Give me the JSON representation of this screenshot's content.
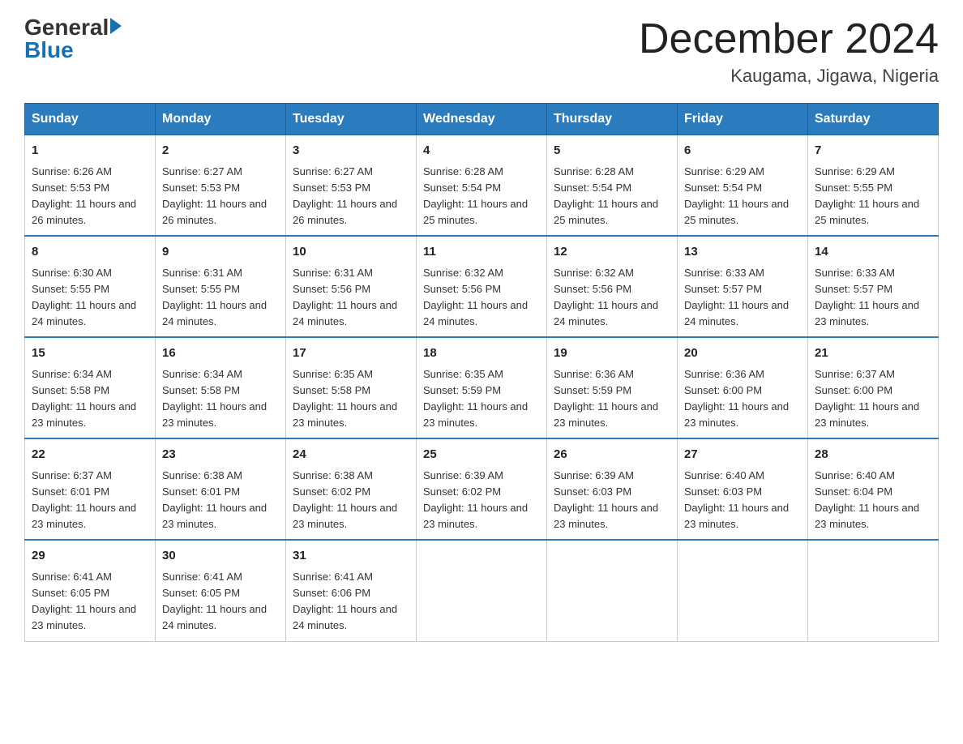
{
  "header": {
    "logo": {
      "general": "General",
      "blue": "Blue",
      "tagline": ""
    },
    "title": "December 2024",
    "location": "Kaugama, Jigawa, Nigeria"
  },
  "days_of_week": [
    "Sunday",
    "Monday",
    "Tuesday",
    "Wednesday",
    "Thursday",
    "Friday",
    "Saturday"
  ],
  "weeks": [
    [
      {
        "day": 1,
        "sunrise": "6:26 AM",
        "sunset": "5:53 PM",
        "daylight": "11 hours and 26 minutes."
      },
      {
        "day": 2,
        "sunrise": "6:27 AM",
        "sunset": "5:53 PM",
        "daylight": "11 hours and 26 minutes."
      },
      {
        "day": 3,
        "sunrise": "6:27 AM",
        "sunset": "5:53 PM",
        "daylight": "11 hours and 26 minutes."
      },
      {
        "day": 4,
        "sunrise": "6:28 AM",
        "sunset": "5:54 PM",
        "daylight": "11 hours and 25 minutes."
      },
      {
        "day": 5,
        "sunrise": "6:28 AM",
        "sunset": "5:54 PM",
        "daylight": "11 hours and 25 minutes."
      },
      {
        "day": 6,
        "sunrise": "6:29 AM",
        "sunset": "5:54 PM",
        "daylight": "11 hours and 25 minutes."
      },
      {
        "day": 7,
        "sunrise": "6:29 AM",
        "sunset": "5:55 PM",
        "daylight": "11 hours and 25 minutes."
      }
    ],
    [
      {
        "day": 8,
        "sunrise": "6:30 AM",
        "sunset": "5:55 PM",
        "daylight": "11 hours and 24 minutes."
      },
      {
        "day": 9,
        "sunrise": "6:31 AM",
        "sunset": "5:55 PM",
        "daylight": "11 hours and 24 minutes."
      },
      {
        "day": 10,
        "sunrise": "6:31 AM",
        "sunset": "5:56 PM",
        "daylight": "11 hours and 24 minutes."
      },
      {
        "day": 11,
        "sunrise": "6:32 AM",
        "sunset": "5:56 PM",
        "daylight": "11 hours and 24 minutes."
      },
      {
        "day": 12,
        "sunrise": "6:32 AM",
        "sunset": "5:56 PM",
        "daylight": "11 hours and 24 minutes."
      },
      {
        "day": 13,
        "sunrise": "6:33 AM",
        "sunset": "5:57 PM",
        "daylight": "11 hours and 24 minutes."
      },
      {
        "day": 14,
        "sunrise": "6:33 AM",
        "sunset": "5:57 PM",
        "daylight": "11 hours and 23 minutes."
      }
    ],
    [
      {
        "day": 15,
        "sunrise": "6:34 AM",
        "sunset": "5:58 PM",
        "daylight": "11 hours and 23 minutes."
      },
      {
        "day": 16,
        "sunrise": "6:34 AM",
        "sunset": "5:58 PM",
        "daylight": "11 hours and 23 minutes."
      },
      {
        "day": 17,
        "sunrise": "6:35 AM",
        "sunset": "5:58 PM",
        "daylight": "11 hours and 23 minutes."
      },
      {
        "day": 18,
        "sunrise": "6:35 AM",
        "sunset": "5:59 PM",
        "daylight": "11 hours and 23 minutes."
      },
      {
        "day": 19,
        "sunrise": "6:36 AM",
        "sunset": "5:59 PM",
        "daylight": "11 hours and 23 minutes."
      },
      {
        "day": 20,
        "sunrise": "6:36 AM",
        "sunset": "6:00 PM",
        "daylight": "11 hours and 23 minutes."
      },
      {
        "day": 21,
        "sunrise": "6:37 AM",
        "sunset": "6:00 PM",
        "daylight": "11 hours and 23 minutes."
      }
    ],
    [
      {
        "day": 22,
        "sunrise": "6:37 AM",
        "sunset": "6:01 PM",
        "daylight": "11 hours and 23 minutes."
      },
      {
        "day": 23,
        "sunrise": "6:38 AM",
        "sunset": "6:01 PM",
        "daylight": "11 hours and 23 minutes."
      },
      {
        "day": 24,
        "sunrise": "6:38 AM",
        "sunset": "6:02 PM",
        "daylight": "11 hours and 23 minutes."
      },
      {
        "day": 25,
        "sunrise": "6:39 AM",
        "sunset": "6:02 PM",
        "daylight": "11 hours and 23 minutes."
      },
      {
        "day": 26,
        "sunrise": "6:39 AM",
        "sunset": "6:03 PM",
        "daylight": "11 hours and 23 minutes."
      },
      {
        "day": 27,
        "sunrise": "6:40 AM",
        "sunset": "6:03 PM",
        "daylight": "11 hours and 23 minutes."
      },
      {
        "day": 28,
        "sunrise": "6:40 AM",
        "sunset": "6:04 PM",
        "daylight": "11 hours and 23 minutes."
      }
    ],
    [
      {
        "day": 29,
        "sunrise": "6:41 AM",
        "sunset": "6:05 PM",
        "daylight": "11 hours and 23 minutes."
      },
      {
        "day": 30,
        "sunrise": "6:41 AM",
        "sunset": "6:05 PM",
        "daylight": "11 hours and 24 minutes."
      },
      {
        "day": 31,
        "sunrise": "6:41 AM",
        "sunset": "6:06 PM",
        "daylight": "11 hours and 24 minutes."
      },
      null,
      null,
      null,
      null
    ]
  ]
}
